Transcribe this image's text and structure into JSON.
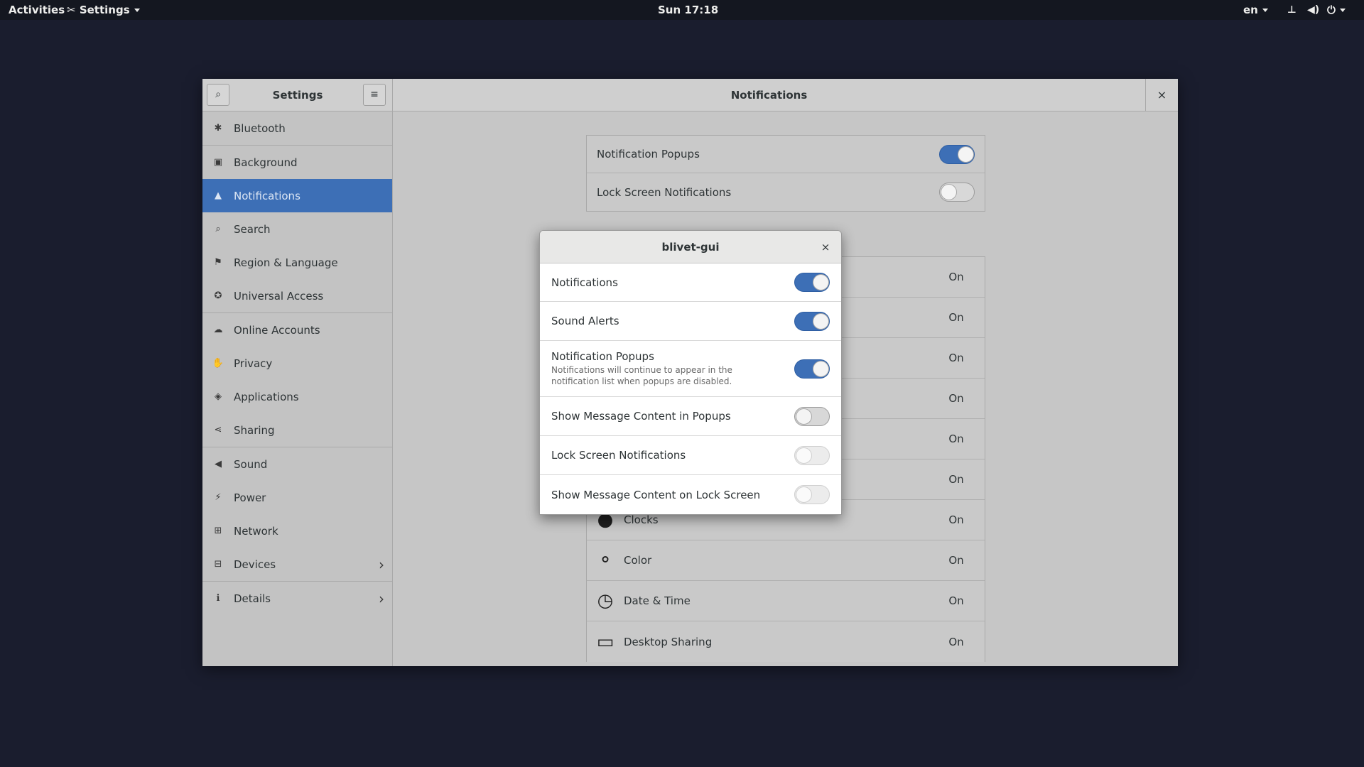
{
  "topbar": {
    "activities": "Activities",
    "app_menu": "Settings",
    "clock": "Sun 17:18",
    "language": "en"
  },
  "window": {
    "sidebar_title": "Settings",
    "panel_title": "Notifications",
    "close_symbol": "×"
  },
  "sidebar": {
    "items": [
      {
        "label": "Bluetooth",
        "icon": "bluetooth-icon",
        "glyph": "✱"
      },
      {
        "label": "Background",
        "icon": "background-icon",
        "glyph": "▣"
      },
      {
        "label": "Notifications",
        "icon": "bell-icon",
        "glyph": "▲"
      },
      {
        "label": "Search",
        "icon": "search-icon",
        "glyph": "⌕"
      },
      {
        "label": "Region & Language",
        "icon": "flag-icon",
        "glyph": "⚑"
      },
      {
        "label": "Universal Access",
        "icon": "universal-access-icon",
        "glyph": "✪"
      },
      {
        "label": "Online Accounts",
        "icon": "cloud-icon",
        "glyph": "☁"
      },
      {
        "label": "Privacy",
        "icon": "hand-icon",
        "glyph": "✋"
      },
      {
        "label": "Applications",
        "icon": "applications-icon",
        "glyph": "◈"
      },
      {
        "label": "Sharing",
        "icon": "share-icon",
        "glyph": "⋖"
      },
      {
        "label": "Sound",
        "icon": "speaker-icon",
        "glyph": "◀"
      },
      {
        "label": "Power",
        "icon": "power-icon",
        "glyph": "⚡"
      },
      {
        "label": "Network",
        "icon": "network-icon",
        "glyph": "⊞"
      },
      {
        "label": "Devices",
        "icon": "devices-icon",
        "glyph": "⊟"
      },
      {
        "label": "Details",
        "icon": "info-icon",
        "glyph": "ℹ"
      }
    ]
  },
  "main": {
    "global": [
      {
        "label": "Notification Popups",
        "on": true
      },
      {
        "label": "Lock Screen Notifications",
        "on": false
      }
    ],
    "apps": [
      {
        "label": "Clocks",
        "state": "On",
        "icon": "clocks-icon",
        "glyph": "●"
      },
      {
        "label": "Color",
        "state": "On",
        "icon": "color-icon",
        "glyph": "⚬"
      },
      {
        "label": "Date & Time",
        "state": "On",
        "icon": "date-time-icon",
        "glyph": "◷"
      },
      {
        "label": "Desktop Sharing",
        "state": "On",
        "icon": "desktop-sharing-icon",
        "glyph": "▭"
      }
    ],
    "hidden_states": [
      "On",
      "On",
      "On",
      "On",
      "On",
      "On"
    ]
  },
  "dialog": {
    "title": "blivet-gui",
    "close_symbol": "×",
    "rows": [
      {
        "label": "Notifications",
        "on": true
      },
      {
        "label": "Sound Alerts",
        "on": true
      },
      {
        "label": "Notification Popups",
        "sub": "Notifications will continue to appear in the notification list when popups are disabled.",
        "on": true
      },
      {
        "label": "Show Message Content in Popups",
        "on": false
      },
      {
        "label": "Lock Screen Notifications",
        "on": false,
        "dim": true
      },
      {
        "label": "Show Message Content on Lock Screen",
        "on": false,
        "dim": true
      }
    ]
  },
  "colors": {
    "accent": "#3d6fb6",
    "desktop": "#1a1d2e"
  }
}
